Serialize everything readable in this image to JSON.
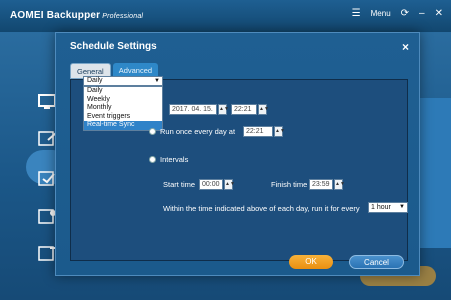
{
  "app": {
    "title": "AOMEI Backupper",
    "subtitle": "Professional",
    "menu_label": "Menu",
    "icons": {
      "menu": "menu-icon",
      "refresh": "refresh-icon",
      "minimize": "minimize-icon",
      "close": "close-icon"
    }
  },
  "modal": {
    "title": "Schedule Settings",
    "close_glyph": "×",
    "tabs": [
      {
        "label": "General"
      },
      {
        "label": "Advanced"
      }
    ],
    "frequency": {
      "selected": "Daily",
      "options": [
        "Daily",
        "Weekly",
        "Monthly",
        "Event triggers",
        "Real-time Sync"
      ],
      "highlighted": "Real-time Sync"
    },
    "start_date": "2017. 04. 15.",
    "start_clock": "22:21",
    "run_once_label": "Run once every day at",
    "run_once_time": "22:21",
    "intervals_label": "Intervals",
    "start_time_label": "Start time",
    "start_time_value": "00:00",
    "finish_time_label": "Finish time",
    "finish_time_value": "23:59",
    "every_label": "Within the time indicated above of each day, run it for every",
    "every_value": "1 hour",
    "ok_label": "OK",
    "cancel_label": "Cancel"
  },
  "colors": {
    "accent_orange": "#ea8f10",
    "accent_blue": "#2f82c8",
    "panel_bg": "#1b5a8c"
  }
}
